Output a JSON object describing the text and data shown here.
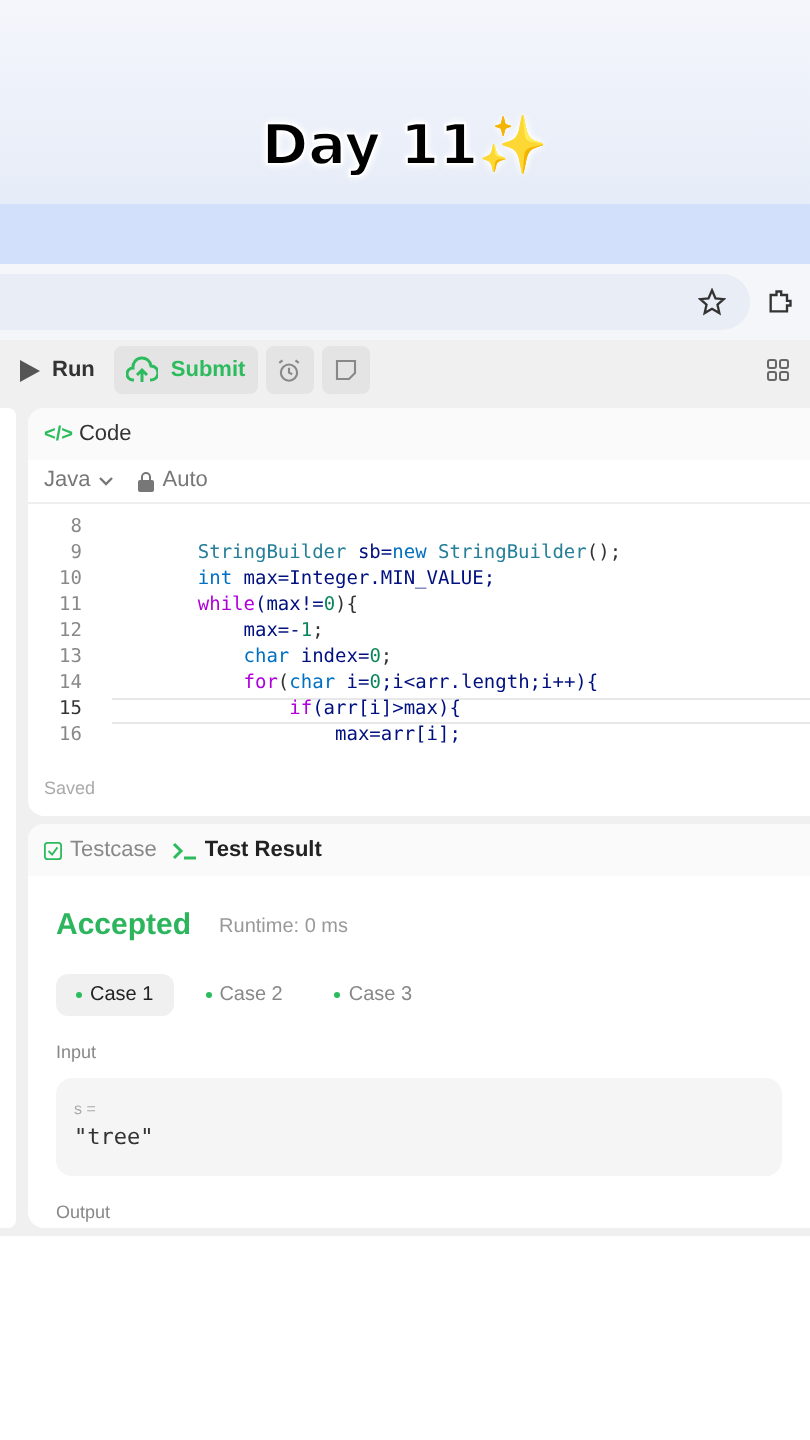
{
  "caption": {
    "text": "Day 11",
    "emoji": "✨"
  },
  "toolbar": {
    "buttons": [
      {
        "label": "Run",
        "kind": "run"
      },
      {
        "label": "Submit",
        "kind": "submit"
      }
    ]
  },
  "code_panel": {
    "icon": "</>",
    "title": "Code",
    "language": "Java",
    "mode": "Auto",
    "status": "Saved",
    "lines": [
      {
        "number": "8",
        "current": false
      },
      {
        "number": "9",
        "current": false,
        "tokens": [
          {
            "t": "    StringBuilder",
            "kind": "type"
          },
          {
            "t": " sb=",
            "kind": "var"
          },
          {
            "t": "new",
            "kind": "kw"
          },
          {
            "t": " StringBuilder",
            "kind": "type"
          },
          {
            "t": "();",
            "kind": "plain"
          }
        ]
      },
      {
        "number": "10",
        "current": false,
        "tokens": [
          {
            "t": "    int",
            "kind": "kw"
          },
          {
            "t": " max=Integer.MIN_VALUE;",
            "kind": "var"
          }
        ]
      },
      {
        "number": "11",
        "current": false,
        "tokens": [
          {
            "t": "    while",
            "kind": "ctrl"
          },
          {
            "t": "(max!=",
            "kind": "var"
          },
          {
            "t": "0",
            "kind": "num"
          },
          {
            "t": "){",
            "kind": "plain"
          }
        ]
      },
      {
        "number": "12",
        "current": false,
        "tokens": [
          {
            "t": "        max=-",
            "kind": "var"
          },
          {
            "t": "1",
            "kind": "num"
          },
          {
            "t": ";",
            "kind": "plain"
          }
        ]
      },
      {
        "number": "13",
        "current": false,
        "tokens": [
          {
            "t": "        char",
            "kind": "kw"
          },
          {
            "t": " index=",
            "kind": "var"
          },
          {
            "t": "0",
            "kind": "num"
          },
          {
            "t": ";",
            "kind": "plain"
          }
        ]
      },
      {
        "number": "14",
        "current": false,
        "tokens": [
          {
            "t": "        for",
            "kind": "ctrl"
          },
          {
            "t": "(",
            "kind": "plain"
          },
          {
            "t": "char",
            "kind": "kw"
          },
          {
            "t": " i=",
            "kind": "var"
          },
          {
            "t": "0",
            "kind": "num"
          },
          {
            "t": ";i<arr.length;i++){",
            "kind": "var"
          }
        ]
      },
      {
        "number": "15",
        "current": true,
        "tokens": [
          {
            "t": "            if",
            "kind": "ctrl"
          },
          {
            "t": "(arr[i]>max){",
            "kind": "var"
          }
        ]
      },
      {
        "number": "16",
        "current": false,
        "tokens": [
          {
            "t": "                max=arr[i];",
            "kind": "var"
          }
        ]
      }
    ]
  },
  "result_panel": {
    "tabs": [
      {
        "label": "Testcase",
        "kind": "testcase",
        "selected": false
      },
      {
        "label": "Test Result",
        "kind": "result",
        "selected": true
      }
    ],
    "verdict": "Accepted",
    "runtime": "Runtime: 0 ms",
    "cases": [
      {
        "label": "Case 1",
        "selected": true
      },
      {
        "label": "Case 2",
        "selected": false
      },
      {
        "label": "Case 3",
        "selected": false
      }
    ],
    "input_label": "Input",
    "input_var": "s =",
    "input_value": "\"tree\"",
    "output_label": "Output"
  }
}
